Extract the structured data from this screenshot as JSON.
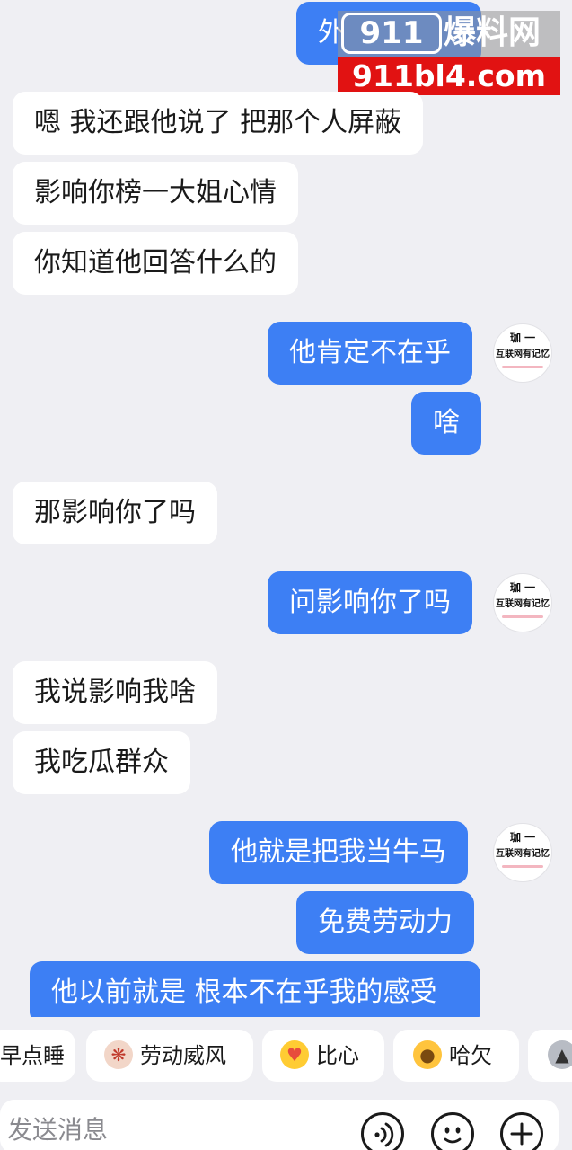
{
  "watermark": {
    "brand_num": "911",
    "brand_cn": "爆料网",
    "url": "911bl4.com",
    "partial_bubble_text": "外"
  },
  "avatar": {
    "line1": "珈 一",
    "line2": "互联网有记忆"
  },
  "messages": [
    {
      "side": "left",
      "text": "嗯 我还跟他说了 把那个人屏蔽"
    },
    {
      "side": "left",
      "text": "影响你榜一大姐心情"
    },
    {
      "side": "left",
      "text": "你知道他回答什么的"
    },
    {
      "side": "right",
      "text": "他肯定不在乎"
    },
    {
      "side": "right",
      "text": "啥"
    },
    {
      "side": "left",
      "text": "那影响你了吗"
    },
    {
      "side": "right",
      "text": "问影响你了吗"
    },
    {
      "side": "left",
      "text": "我说影响我啥"
    },
    {
      "side": "left",
      "text": "我吃瓜群众"
    },
    {
      "side": "right",
      "text": "他就是把我当牛马"
    },
    {
      "side": "right",
      "text": "免费劳动力"
    },
    {
      "side": "right",
      "text": "他以前就是 根本不在乎我的感受"
    }
  ],
  "quick_replies": [
    {
      "label": "早点睡",
      "icon": "sleep-emoji-icon"
    },
    {
      "label": "劳动威风",
      "icon": "crab-emoji-icon"
    },
    {
      "label": "比心",
      "icon": "heart-hands-emoji-icon"
    },
    {
      "label": "哈欠",
      "icon": "yawn-emoji-icon"
    },
    {
      "label": "",
      "icon": "cat-emoji-icon"
    }
  ],
  "input": {
    "placeholder": "发送消息"
  },
  "icons": {
    "voice": "voice-icon",
    "emoji": "emoji-icon",
    "plus": "plus-icon"
  },
  "colors": {
    "background": "#efeff3",
    "bubble_self": "#3d7ff4",
    "bubble_other": "#ffffff",
    "watermark_red": "#e11212"
  }
}
